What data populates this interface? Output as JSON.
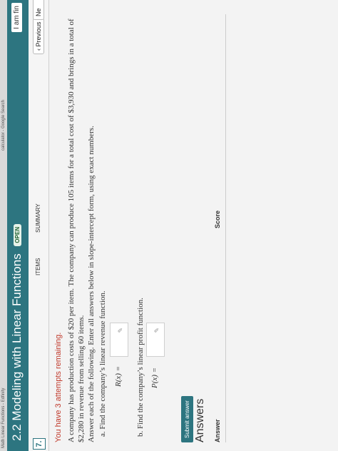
{
  "browser": {
    "tab_left": "Math Linear Functions - Edfinity",
    "tab_right": "calculator - Google Search"
  },
  "header": {
    "title": "2.2 Modeling with Linear Functions",
    "badge": "OPEN",
    "user": "I am fin"
  },
  "subnav": {
    "question_number": "7.",
    "tabs": [
      "ITEMS",
      "SUMMARY"
    ],
    "previous": "‹ Previous",
    "next": "Ne"
  },
  "problem": {
    "attempts": "You have 3 attempts remaining.",
    "text": "A company has production costs of $20 per item. The company can produce 105 items for a total cost of $3,930 and brings in a total of $2,280 in revenue from selling 60 items.",
    "instructions": "Answer each of the following. Enter all answers below in slope-intercept form, using exact numbers.",
    "part_a": "a.  Find the company’s linear revenue function.",
    "r_label": "R(x) =",
    "part_b": "b.  Find the company’s linear profit function.",
    "p_label": "P(x) =",
    "input_icon": "✎"
  },
  "submit": "Submit answer",
  "answers": {
    "title": "Answers",
    "columns": [
      "Answer",
      "Score"
    ]
  }
}
